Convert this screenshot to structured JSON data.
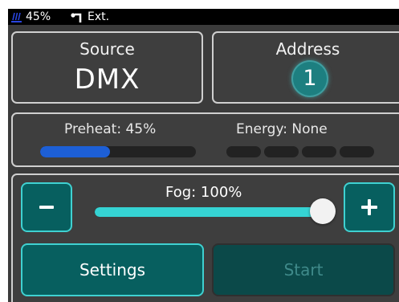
{
  "status_bar": {
    "heater_icon": "heater-icon",
    "preheat_percent": "45%",
    "pump_icon": "pump-icon",
    "source_short": "Ext."
  },
  "source": {
    "title": "Source",
    "value": "DMX"
  },
  "address": {
    "title": "Address",
    "value": "1"
  },
  "preheat": {
    "label": "Preheat: 45%",
    "level_percent": 45,
    "bar_color": "#1d5fd6"
  },
  "energy": {
    "label": "Energy: None",
    "segments_total": 4,
    "segments_lit": 0
  },
  "fog": {
    "label": "Fog: 100%",
    "level_percent": 100,
    "minus_icon": "minus-icon",
    "plus_icon": "plus-icon",
    "accent_color": "#35d3d3"
  },
  "buttons": {
    "settings": "Settings",
    "start": "Start"
  }
}
